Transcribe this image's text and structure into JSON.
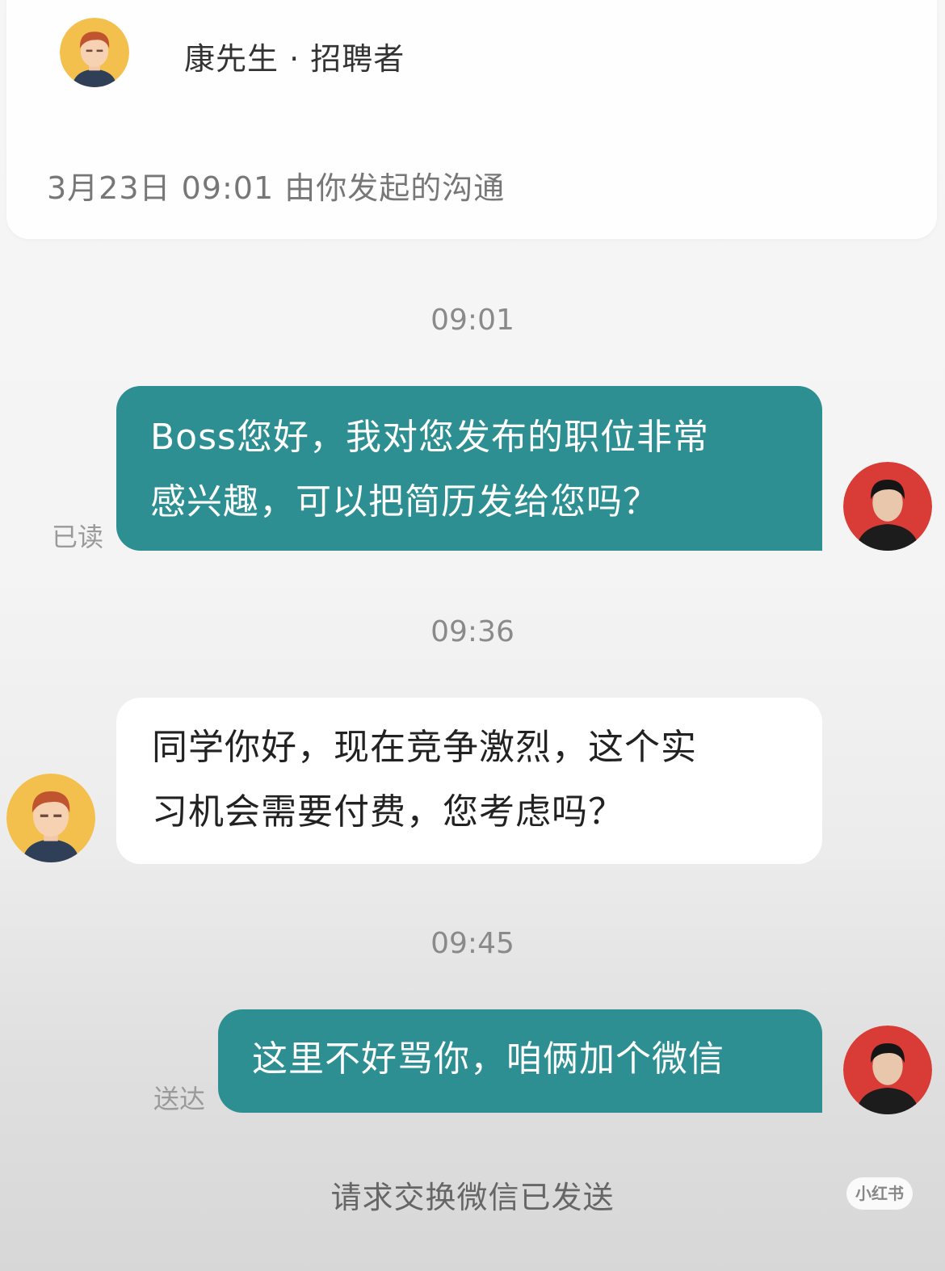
{
  "header": {
    "contact_name": "康先生 · 招聘者",
    "conversation_info": "3月23日 09:01 由你发起的沟通"
  },
  "messages": [
    {
      "time": "09:01",
      "sender": "me",
      "lines": [
        "Boss您好，我对您发布的职位非常",
        "感兴趣，可以把简历发给您吗？"
      ],
      "status": "已读"
    },
    {
      "time": "09:36",
      "sender": "recruiter",
      "lines": [
        "同学你好，现在竞争激烈，这个实",
        "习机会需要付费，您考虑吗？"
      ]
    },
    {
      "time": "09:45",
      "sender": "me",
      "lines": [
        "这里不好骂你，咱俩加个微信"
      ],
      "status": "送达"
    }
  ],
  "system_message": "请求交换微信已发送",
  "watermark": "小红书",
  "colors": {
    "my_bubble": "#2e8f92",
    "their_bubble": "#ffffff",
    "my_avatar_bg": "#d93b36",
    "recruiter_avatar_bg": "#f3c04e"
  }
}
